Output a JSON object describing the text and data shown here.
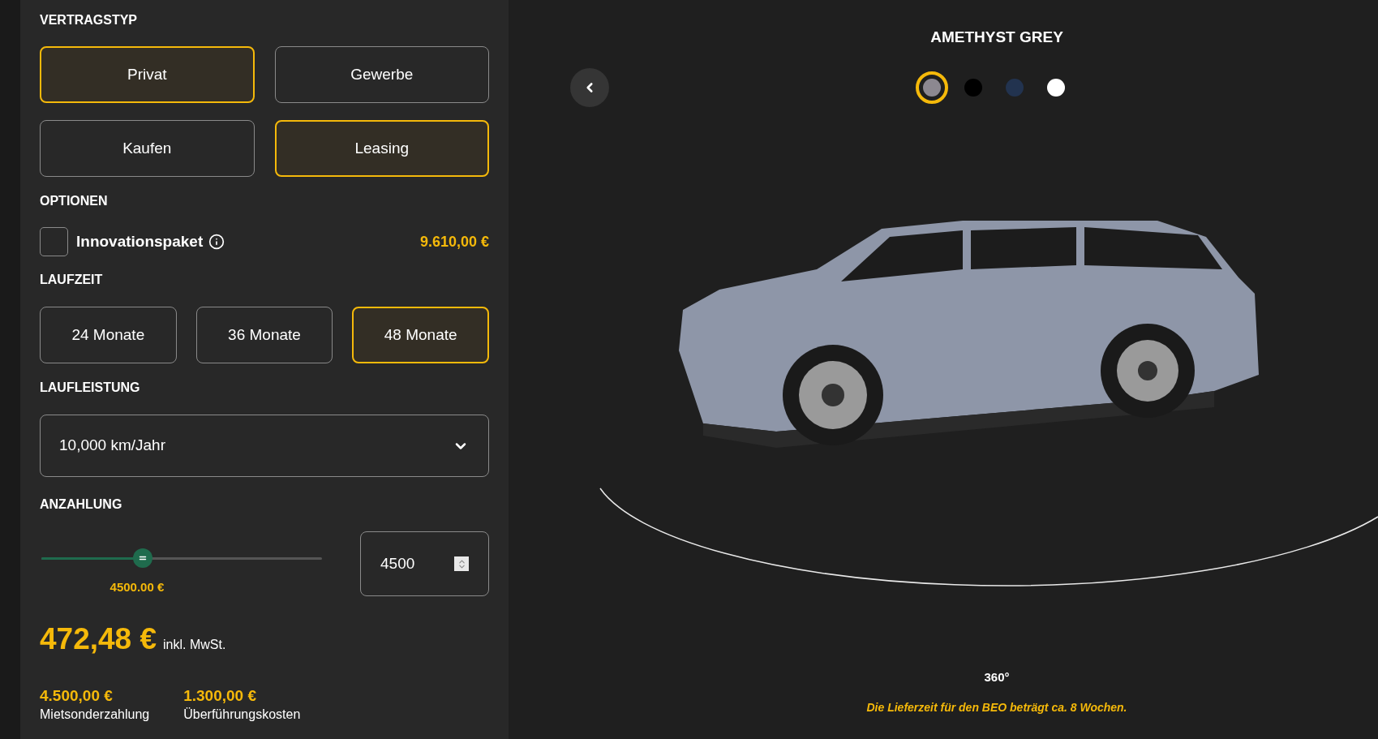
{
  "vertragstyp": {
    "heading": "VERTRAGSTYP",
    "rows": [
      {
        "options": [
          {
            "label": "Privat",
            "selected": true
          },
          {
            "label": "Gewerbe",
            "selected": false
          }
        ]
      },
      {
        "options": [
          {
            "label": "Kaufen",
            "selected": false
          },
          {
            "label": "Leasing",
            "selected": true
          }
        ]
      }
    ]
  },
  "optionen": {
    "heading": "OPTIONEN",
    "items": [
      {
        "label": "Innovationspaket",
        "checked": false,
        "price": "9.610,00 €"
      }
    ]
  },
  "laufzeit": {
    "heading": "LAUFZEIT",
    "options": [
      {
        "label": "24 Monate",
        "selected": false
      },
      {
        "label": "36 Monate",
        "selected": false
      },
      {
        "label": "48 Monate",
        "selected": true
      }
    ]
  },
  "laufleistung": {
    "heading": "LAUFLEISTUNG",
    "value": "10,000 km/Jahr"
  },
  "anzahlung": {
    "heading": "ANZAHLUNG",
    "level": 0.36,
    "reading": "4500.00 €",
    "input_value": "4500"
  },
  "price": {
    "amount": "472,48 €",
    "note": "inkl. MwSt."
  },
  "summary": [
    {
      "value": "4.500,00 €",
      "label": "Mietsonderzahlung"
    },
    {
      "value": "1.300,00 €",
      "label": "Überführungskosten"
    }
  ],
  "color_name": "AMETHYST GREY",
  "colors": [
    {
      "color": "#8c8890",
      "selected": true
    },
    {
      "color": "#000000",
      "selected": false
    },
    {
      "color": "#22334f",
      "selected": false
    },
    {
      "color": "#ffffff",
      "selected": false
    }
  ],
  "view_label": "360°",
  "delivery_note": "Die Lieferzeit für den BEO beträgt ca. 8 Wochen."
}
